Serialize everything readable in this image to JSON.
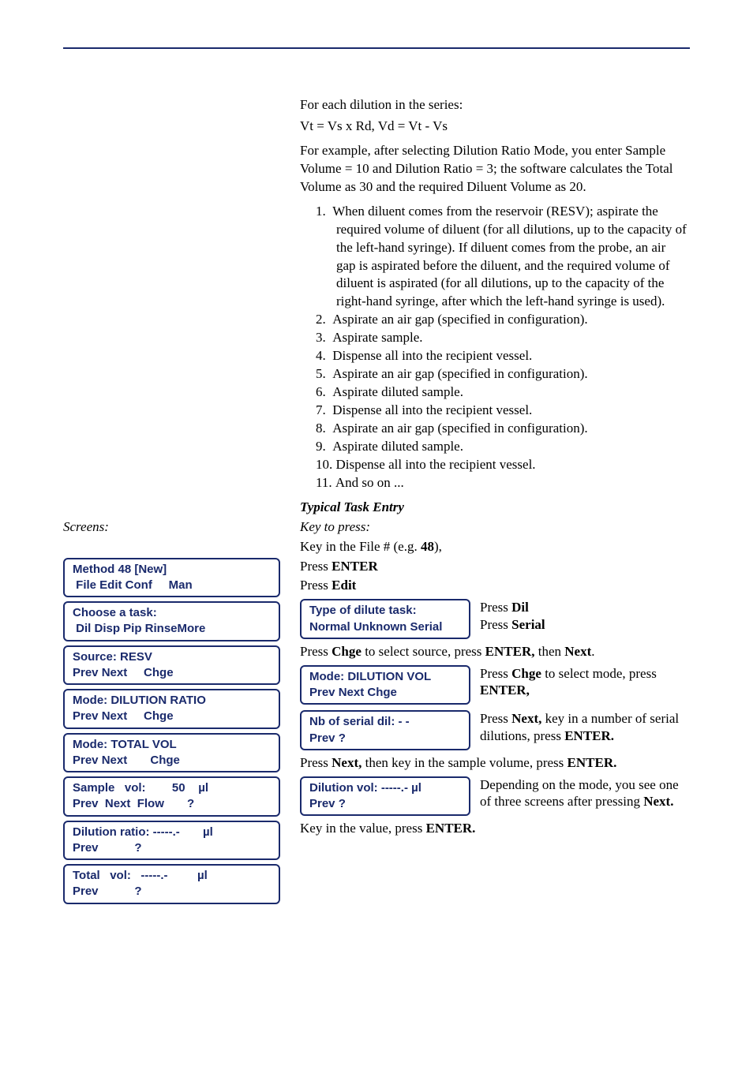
{
  "intro": {
    "line1": "For each dilution in the series:",
    "line2": "Vt = Vs x Rd, Vd = Vt - Vs",
    "para": "For example, after selecting Dilution Ratio Mode, you enter Sample Volume = 10 and Dilution Ratio = 3; the software calculates the Total Volume as 30 and the required Diluent Volume as 20."
  },
  "steps": {
    "s1": "When diluent comes from the reservoir (RESV); aspirate the required volume of diluent (for all dilutions, up to the capacity of the left-hand syringe). If diluent comes from the probe, an air gap is aspirated before the diluent, and the required volume of diluent is aspirated (for all dilutions, up to the capacity of the right-hand syringe, after which the left-hand syringe is used).",
    "s2": "Aspirate an air gap (specified in configuration).",
    "s3": "Aspirate sample.",
    "s4": "Dispense all into the recipient vessel.",
    "s5": "Aspirate an air gap (specified in configuration).",
    "s6": "Aspirate diluted sample.",
    "s7": "Dispense all into the recipient vessel.",
    "s8": "Aspirate an air gap (specified in configuration).",
    "s9": "Aspirate diluted sample.",
    "s10": "Dispense all into the recipient vessel.",
    "s11": "And so on ..."
  },
  "typical": {
    "title": "Typical Task Entry",
    "key_to_press": "Key to press:",
    "keyin_a": "Key in the File # (e.g. ",
    "keyin_b": "48",
    "keyin_c": "),",
    "press": "Press ",
    "enter": "ENTER",
    "edit": "Edit"
  },
  "screens_label": "Screens:",
  "lcd_left": {
    "l1a": "Method 48 [New]",
    "l1b": " File Edit Conf     Man",
    "l2a": "Choose a task:",
    "l2b": " Dil Disp Pip RinseMore",
    "l3a": "Source: RESV",
    "l3b": "Prev Next     Chge",
    "l4a": "Mode: DILUTION RATIO",
    "l4b": "Prev Next     Chge",
    "l5a": "Mode: TOTAL VOL",
    "l5b": "Prev Next       Chge",
    "l6a": "Sample   vol:        50    µl",
    "l6b": "Prev  Next  Flow       ?",
    "l7a": "Dilution ratio: -----.-       µl",
    "l7b": "Prev           ?",
    "l8a": "Total   vol:   -----.-         µl",
    "l8b": "Prev           ?"
  },
  "lcd_right": {
    "r1a": "Type of dilute task:",
    "r1b": "Normal   Unknown  Serial",
    "r2a": "Mode: DILUTION VOL",
    "r2b": "Prev Next     Chge",
    "r3a": "Nb of serial dil:  - -",
    "r3b": "Prev                       ?",
    "r4a": "Dilution   vol: -----.-      µl",
    "r4b": "Prev           ?"
  },
  "rtext": {
    "dil": "Dil",
    "serial": "Serial",
    "chge_a": "Press ",
    "chge_b": "Chge",
    "chge_c": " to select source, press ",
    "chge_d": "ENTER,",
    "chge_e": " then ",
    "chge_f": "Next",
    "chge_g": ".",
    "mode_a": "Press ",
    "mode_b": "Chge",
    "mode_c": " to select mode, press ",
    "mode_d": "ENTER,",
    "serialn_a": "Press ",
    "serialn_b": "Next,",
    "serialn_c": " key in a number of serial dilutions, press ",
    "serialn_d": "ENTER.",
    "samp_a": "Press ",
    "samp_b": "Next,",
    "samp_c": " then key in the sample volume, press ",
    "samp_d": "ENTER.",
    "dep_a": "Depending on the mode, you see one of three screens after pressing ",
    "dep_b": "Next.",
    "keyin_a": "Key in the value, press ",
    "keyin_b": "ENTER."
  }
}
